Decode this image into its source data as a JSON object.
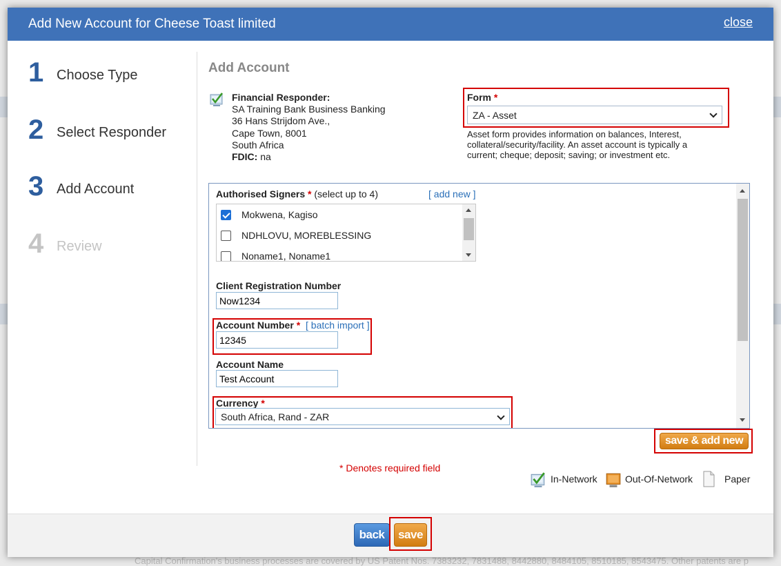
{
  "modal": {
    "title": "Add New Account for Cheese Toast limited",
    "close_label": "close"
  },
  "steps": [
    {
      "number": "1",
      "label": "Choose Type",
      "active": true
    },
    {
      "number": "2",
      "label": "Select Responder",
      "active": true
    },
    {
      "number": "3",
      "label": "Add Account",
      "active": true
    },
    {
      "number": "4",
      "label": "Review",
      "active": false
    }
  ],
  "section_title": "Add Account",
  "responder": {
    "icon": "in-network-icon",
    "heading": "Financial Responder:",
    "name": "SA Training Bank Business Banking",
    "address_line1": "36 Hans Strijdom Ave.,",
    "address_line2": "Cape Town, 8001",
    "country": "South Africa",
    "fdic_label": "FDIC:",
    "fdic_value": "na"
  },
  "form_field": {
    "label": "Form",
    "required_mark": "*",
    "selected": "ZA - Asset",
    "description": "Asset form provides information on balances, Interest, collateral/security/facility. An asset account is typically a current; cheque; deposit; saving; or investment etc."
  },
  "signers": {
    "label": "Authorised Signers",
    "required_mark": "*",
    "note": "(select up to 4)",
    "add_new_label": "[ add new ]",
    "items": [
      {
        "name": "Mokwena, Kagiso",
        "checked": true
      },
      {
        "name": "NDHLOVU, MOREBLESSING",
        "checked": false
      },
      {
        "name": "Noname1, Noname1",
        "checked": false
      }
    ]
  },
  "client_registration": {
    "label": "Client Registration Number",
    "value": "Now1234"
  },
  "account_number": {
    "label": "Account Number",
    "required_mark": "*",
    "batch_import_label": "[ batch import ]",
    "value": "12345"
  },
  "account_name": {
    "label": "Account Name",
    "value": "Test Account"
  },
  "currency": {
    "label": "Currency",
    "required_mark": "*",
    "selected": "South Africa, Rand - ZAR"
  },
  "buttons": {
    "save_add_new": "save & add new",
    "back": "back",
    "save": "save"
  },
  "required_note": "* Denotes required field",
  "legend": [
    {
      "icon": "in-network-icon",
      "label": "In-Network"
    },
    {
      "icon": "out-of-network-icon",
      "label": "Out-Of-Network"
    },
    {
      "icon": "paper-icon",
      "label": "Paper"
    }
  ],
  "background_footer": "Capital Confirmation's business processes are covered by US Patent Nos. 7383232, 7831488, 8442880, 8484105, 8510185, 8543475. Other patents are p",
  "colors": {
    "header_blue": "#3f72b8",
    "step_blue": "#2e5e9e",
    "required_red": "#d40000",
    "highlight_red": "#d40000",
    "button_orange": "#e08f25",
    "button_blue": "#3a7bcc"
  }
}
